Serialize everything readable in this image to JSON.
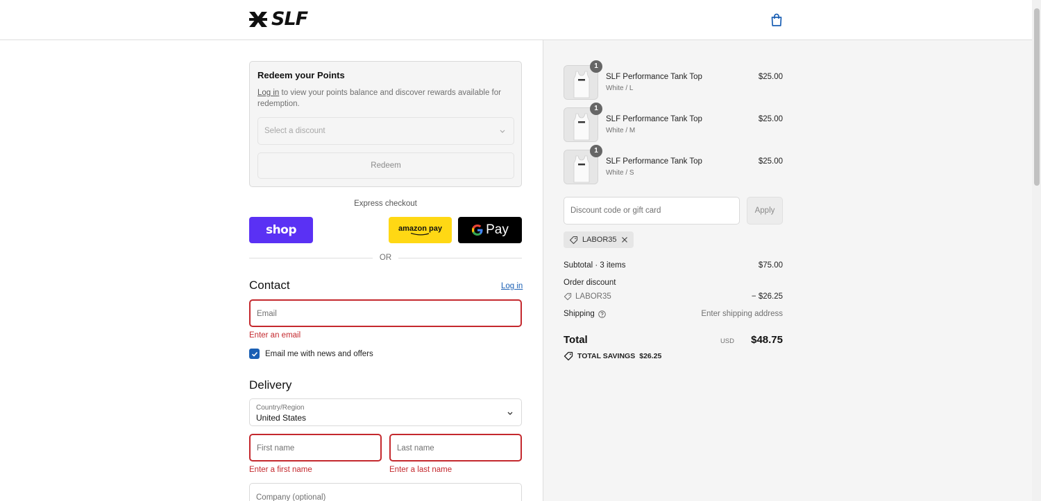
{
  "brand": {
    "name": "SLF"
  },
  "redeem": {
    "title": "Redeem your Points",
    "login_link": "Log in",
    "description": " to view your points balance and discover rewards available for redemption.",
    "select_placeholder": "Select a discount",
    "button": "Redeem"
  },
  "express": {
    "label": "Express checkout",
    "shop": "shop",
    "amazon": "amazon pay",
    "gpay": "Pay",
    "or": "OR"
  },
  "contact": {
    "title": "Contact",
    "login": "Log in",
    "email_placeholder": "Email",
    "email_error": "Enter an email",
    "newsletter": "Email me with news and offers",
    "newsletter_checked": true
  },
  "delivery": {
    "title": "Delivery",
    "country_label": "Country/Region",
    "country_value": "United States",
    "first_name_placeholder": "First name",
    "first_name_error": "Enter a first name",
    "last_name_placeholder": "Last name",
    "last_name_error": "Enter a last name",
    "company_placeholder": "Company (optional)"
  },
  "cart": {
    "items": [
      {
        "qty": "1",
        "name": "SLF Performance Tank Top",
        "variant": "White / L",
        "price": "$25.00"
      },
      {
        "qty": "1",
        "name": "SLF Performance Tank Top",
        "variant": "White / M",
        "price": "$25.00"
      },
      {
        "qty": "1",
        "name": "SLF Performance Tank Top",
        "variant": "White / S",
        "price": "$25.00"
      }
    ],
    "discount_placeholder": "Discount code or gift card",
    "apply": "Apply",
    "applied_code": "LABOR35"
  },
  "totals": {
    "subtotal_label": "Subtotal · 3 items",
    "subtotal": "$75.00",
    "order_discount_label": "Order discount",
    "discount_code": "LABOR35",
    "discount_amount": "− $26.25",
    "shipping_label": "Shipping",
    "shipping_value": "Enter shipping address",
    "total_label": "Total",
    "currency": "USD",
    "total": "$48.75",
    "savings_label": "TOTAL SAVINGS",
    "savings": "$26.25"
  },
  "colors": {
    "accent": "#1a5fb4",
    "error": "#c4282d",
    "shop_pay": "#5a31f4",
    "amazon_pay": "#ffd814"
  }
}
